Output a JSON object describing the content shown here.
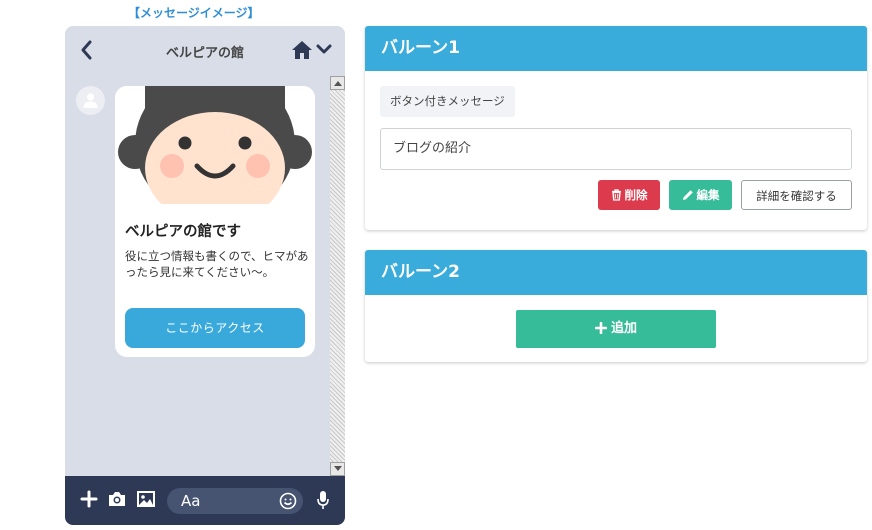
{
  "preview": {
    "label": "【メッセージイメージ】"
  },
  "phone": {
    "header_title": "ベルピアの館",
    "bubble": {
      "title": "ベルピアの館です",
      "text": "役に立つ情報も書くので、ヒマがあったら見に来てください〜。",
      "button_label": "ここからアクセス"
    },
    "input_placeholder": "Aa"
  },
  "balloons": [
    {
      "title": "バルーン1",
      "type_label": "ボタン付きメッセージ",
      "input_value": "ブログの紹介",
      "delete_label": "削除",
      "edit_label": "編集",
      "detail_label": "詳細を確認する"
    },
    {
      "title": "バルーン2",
      "add_label": "追加"
    }
  ],
  "colors": {
    "accent_blue": "#3aacdb",
    "delete_red": "#dc3b4d",
    "edit_green": "#36bc98",
    "phone_bg": "#d8dde8",
    "phone_footer": "#2e3a55"
  }
}
